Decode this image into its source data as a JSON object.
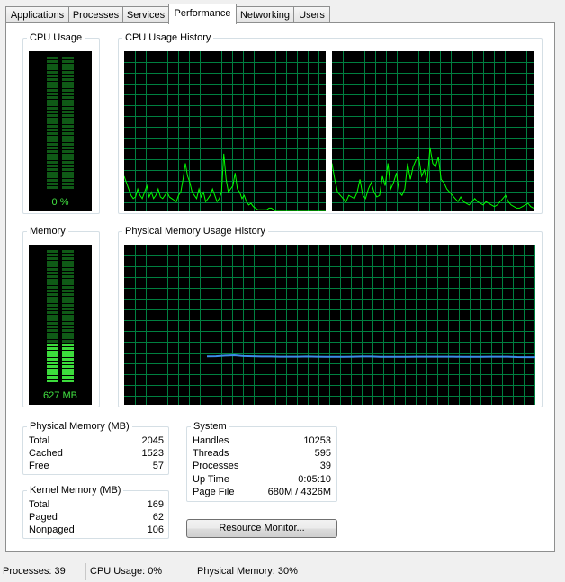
{
  "tabs": [
    {
      "label": "Applications"
    },
    {
      "label": "Processes"
    },
    {
      "label": "Services"
    },
    {
      "label": "Performance"
    },
    {
      "label": "Networking"
    },
    {
      "label": "Users"
    }
  ],
  "active_tab": "Performance",
  "cpu_usage": {
    "title": "CPU Usage",
    "value_label": "0 %",
    "level": 0
  },
  "cpu_history": {
    "title": "CPU Usage History"
  },
  "memory": {
    "title": "Memory",
    "value_label": "627 MB",
    "level": 0.306
  },
  "memory_history": {
    "title": "Physical Memory Usage History"
  },
  "physical_memory": {
    "title": "Physical Memory (MB)",
    "rows": [
      {
        "label": "Total",
        "value": "2045"
      },
      {
        "label": "Cached",
        "value": "1523"
      },
      {
        "label": "Free",
        "value": "57"
      }
    ]
  },
  "kernel_memory": {
    "title": "Kernel Memory (MB)",
    "rows": [
      {
        "label": "Total",
        "value": "169"
      },
      {
        "label": "Paged",
        "value": "62"
      },
      {
        "label": "Nonpaged",
        "value": "106"
      }
    ]
  },
  "system": {
    "title": "System",
    "rows": [
      {
        "label": "Handles",
        "value": "10253"
      },
      {
        "label": "Threads",
        "value": "595"
      },
      {
        "label": "Processes",
        "value": "39"
      },
      {
        "label": "Up Time",
        "value": "0:05:10"
      },
      {
        "label": "Page File",
        "value": "680M / 4326M"
      }
    ]
  },
  "resource_monitor_button": "Resource Monitor...",
  "status_bar": {
    "processes": "Processes: 39",
    "cpu": "CPU Usage: 0%",
    "memory": "Physical Memory: 30%"
  },
  "colors": {
    "graph_grid": "#008040",
    "cpu_line": "#00ff00",
    "memory_line": "#3c8ce8",
    "meter_lit": "#3cdc3c",
    "meter_dim": "#0f5a16"
  },
  "chart_data": [
    {
      "type": "line",
      "series": [
        {
          "values": [
            22,
            18,
            14,
            10,
            8,
            9,
            14,
            10,
            8,
            12,
            16,
            9,
            12,
            8,
            10,
            14,
            9,
            8,
            10,
            12,
            9,
            8,
            7,
            6,
            10,
            12,
            20,
            30,
            22,
            18,
            12,
            10,
            8,
            14,
            9,
            12,
            6,
            8,
            10,
            14,
            10,
            6,
            8,
            12,
            36,
            20,
            12,
            14,
            16,
            24,
            14,
            12,
            8,
            10,
            6,
            4,
            5,
            3,
            2,
            1,
            1,
            1,
            1,
            1,
            2,
            2,
            1,
            0,
            0,
            0,
            0,
            0,
            0,
            0,
            0,
            0,
            0,
            0,
            0,
            0,
            0,
            0,
            0,
            0,
            0,
            0,
            0,
            0,
            0,
            0
          ]
        }
      ],
      "ylim": [
        0,
        100
      ]
    },
    {
      "type": "line",
      "series": [
        {
          "values": [
            30,
            20,
            12,
            10,
            8,
            6,
            10,
            9,
            8,
            12,
            20,
            10,
            8,
            14,
            18,
            12,
            9,
            10,
            22,
            16,
            30,
            14,
            18,
            24,
            12,
            10,
            14,
            30,
            20,
            28,
            32,
            34,
            22,
            26,
            18,
            40,
            30,
            28,
            34,
            20,
            18,
            14,
            12,
            10,
            8,
            6,
            9,
            6,
            5,
            4,
            6,
            8,
            6,
            5,
            4,
            6,
            5,
            4,
            3,
            4,
            6,
            8,
            10,
            6,
            4,
            3,
            2,
            2,
            3,
            4,
            5,
            3,
            2
          ]
        }
      ],
      "ylim": [
        0,
        100
      ]
    },
    {
      "type": "line",
      "series": [
        {
          "values": [
            30.2,
            30.3,
            30.7,
            30.9,
            30.4,
            30.3,
            30.1,
            30.1,
            30.0,
            30.0,
            30.0,
            30.1,
            30.0,
            29.9,
            29.9,
            29.9,
            30.0,
            30.1,
            30.1,
            29.9,
            29.9,
            29.9,
            29.9,
            30.0,
            30.0,
            30.0,
            30.0,
            30.0,
            29.9,
            29.9,
            29.9,
            30.0,
            30.0,
            30.0,
            29.8,
            29.7,
            29.7
          ]
        }
      ],
      "ylim": [
        0,
        100
      ]
    }
  ]
}
